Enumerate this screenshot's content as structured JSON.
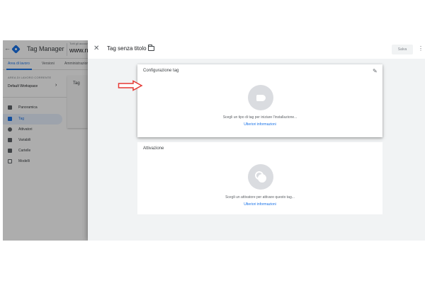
{
  "background_app": {
    "back_icon": "back-arrow-icon",
    "product_name": "Tag Manager",
    "container_label": "Tutti gli account",
    "container_name": "www.n",
    "tabs": [
      "Area di lavoro",
      "Versioni",
      "Amministrazione"
    ],
    "workspace_label": "AREA DI LAVORO CORRENTE",
    "workspace_name": "Default Workspace",
    "nav": [
      {
        "label": "Panoramica",
        "icon": "overview-icon"
      },
      {
        "label": "Tag",
        "icon": "tag-icon",
        "active": true
      },
      {
        "label": "Attivatori",
        "icon": "trigger-icon"
      },
      {
        "label": "Variabili",
        "icon": "variable-icon"
      },
      {
        "label": "Cartelle",
        "icon": "folder-icon"
      },
      {
        "label": "Modelli",
        "icon": "template-icon"
      }
    ],
    "content_title": "Tag"
  },
  "panel": {
    "title": "Tag senza titolo",
    "save_label": "Salva",
    "config_card": {
      "title": "Configurazione tag",
      "description": "Scegli un tipo di tag per iniziare l'installazione...",
      "link": "Ulteriori informazioni"
    },
    "trigger_card": {
      "title": "Attivazione",
      "description": "Scegli un attivatore per attivare questo tag...",
      "link": "Ulteriori informazioni"
    }
  },
  "colors": {
    "accent": "#1a73e8",
    "annotation_arrow": "#e53935",
    "panel_background": "#f1f3f4"
  }
}
